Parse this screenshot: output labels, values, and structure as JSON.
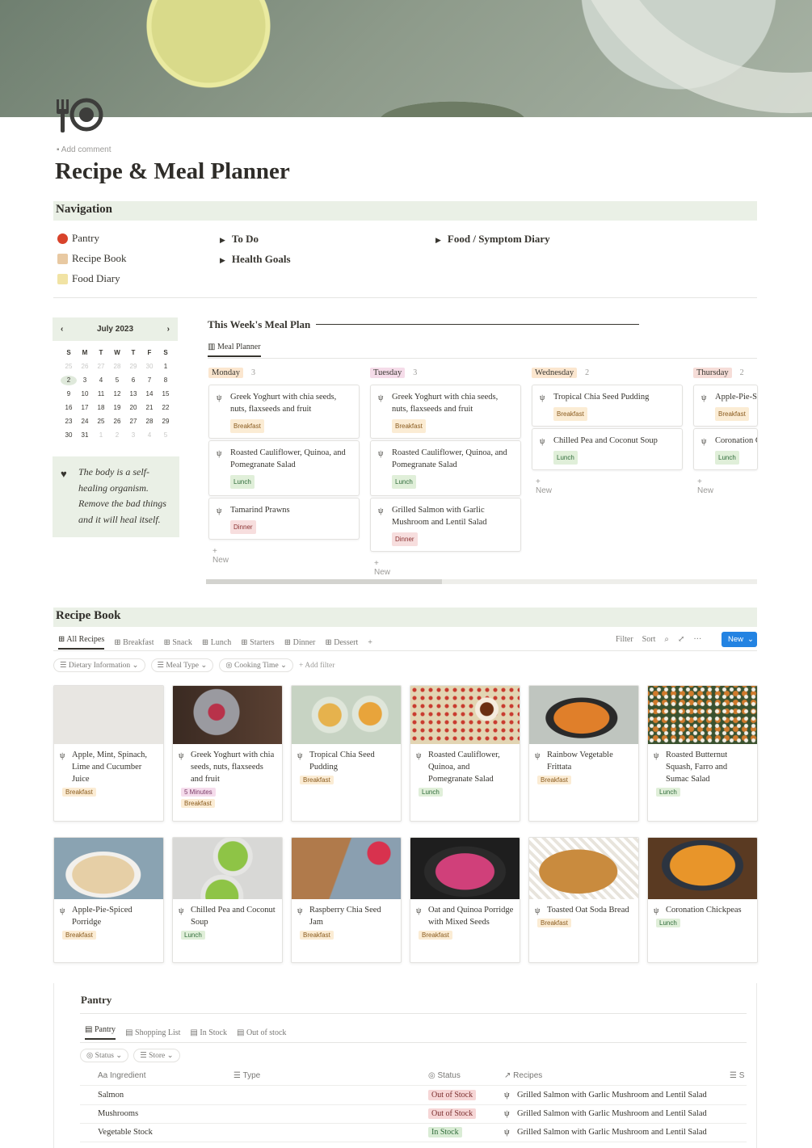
{
  "header": {
    "add_comment": "Add comment",
    "title": "Recipe & Meal Planner",
    "icon": "fork-plate-icon"
  },
  "navigation": {
    "heading": "Navigation",
    "links": [
      {
        "label": "Pantry",
        "icon": "tomato-icon"
      },
      {
        "label": "Recipe Book",
        "icon": "chef-icon"
      },
      {
        "label": "Food Diary",
        "icon": "notepad-icon"
      }
    ],
    "toggles_col2": [
      "To Do",
      "Health Goals"
    ],
    "toggles_col3": [
      "Food / Symptom Diary"
    ]
  },
  "calendar": {
    "month": "July 2023",
    "dow": [
      "S",
      "M",
      "T",
      "W",
      "T",
      "F",
      "S"
    ],
    "weeks": [
      [
        "25",
        "26",
        "27",
        "28",
        "29",
        "30",
        "1"
      ],
      [
        "2",
        "3",
        "4",
        "5",
        "6",
        "7",
        "8"
      ],
      [
        "9",
        "10",
        "11",
        "12",
        "13",
        "14",
        "15"
      ],
      [
        "16",
        "17",
        "18",
        "19",
        "20",
        "21",
        "22"
      ],
      [
        "23",
        "24",
        "25",
        "26",
        "27",
        "28",
        "29"
      ],
      [
        "30",
        "31",
        "1",
        "2",
        "3",
        "4",
        "5"
      ]
    ],
    "selected": "2"
  },
  "quote": {
    "text": "The body is a self-healing organism. Remove the bad things and it will heal itself."
  },
  "meal_plan": {
    "heading": "This Week's Meal Plan",
    "view_tab": "Meal Planner",
    "new_label": "New",
    "columns": [
      {
        "day": "Monday",
        "count": "3",
        "cards": [
          {
            "title": "Greek Yoghurt with chia seeds, nuts, flaxseeds and fruit",
            "tag": "Breakfast"
          },
          {
            "title": "Roasted Cauliflower, Quinoa, and Pomegranate Salad",
            "tag": "Lunch"
          },
          {
            "title": "Tamarind Prawns",
            "tag": "Dinner"
          }
        ]
      },
      {
        "day": "Tuesday",
        "count": "3",
        "cards": [
          {
            "title": "Greek Yoghurt with chia seeds, nuts, flaxseeds and fruit",
            "tag": "Breakfast"
          },
          {
            "title": "Roasted Cauliflower, Quinoa, and Pomegranate Salad",
            "tag": "Lunch"
          },
          {
            "title": "Grilled Salmon with Garlic Mushroom and Lentil Salad",
            "tag": "Dinner"
          }
        ]
      },
      {
        "day": "Wednesday",
        "count": "2",
        "cards": [
          {
            "title": "Tropical Chia Seed Pudding",
            "tag": "Breakfast"
          },
          {
            "title": "Chilled Pea and Coconut Soup",
            "tag": "Lunch"
          }
        ]
      },
      {
        "day": "Thursday",
        "count": "2",
        "cards": [
          {
            "title": "Apple-Pie-Sp",
            "tag": "Breakfast"
          },
          {
            "title": "Coronation C",
            "tag": "Lunch"
          }
        ]
      }
    ]
  },
  "recipe_book": {
    "heading": "Recipe Book",
    "tabs": [
      "All Recipes",
      "Breakfast",
      "Snack",
      "Lunch",
      "Starters",
      "Dinner",
      "Dessert"
    ],
    "actions": {
      "filter": "Filter",
      "sort": "Sort",
      "new": "New"
    },
    "filters": [
      "Dietary Information",
      "Meal Type",
      "Cooking Time"
    ],
    "add_filter": "Add filter",
    "cards": [
      {
        "title": "Apple, Mint, Spinach, Lime and Cucumber Juice",
        "tags": [
          "Breakfast"
        ]
      },
      {
        "title": "Greek Yoghurt with chia seeds, nuts, flaxseeds and fruit",
        "tags": [
          "5 Minutes",
          "Breakfast"
        ]
      },
      {
        "title": "Tropical Chia Seed Pudding",
        "tags": [
          "Breakfast"
        ]
      },
      {
        "title": "Roasted Cauliflower, Quinoa, and Pomegranate Salad",
        "tags": [
          "Lunch"
        ]
      },
      {
        "title": "Rainbow Vegetable Frittata",
        "tags": [
          "Breakfast"
        ]
      },
      {
        "title": "Roasted Butternut Squash, Farro and Sumac Salad",
        "tags": [
          "Lunch"
        ]
      },
      {
        "title": "Apple-Pie-Spiced Porridge",
        "tags": [
          "Breakfast"
        ]
      },
      {
        "title": "Chilled Pea and Coconut Soup",
        "tags": [
          "Lunch"
        ]
      },
      {
        "title": "Raspberry Chia Seed Jam",
        "tags": [
          "Breakfast"
        ]
      },
      {
        "title": "Oat and Quinoa Porridge with Mixed Seeds",
        "tags": [
          "Breakfast"
        ]
      },
      {
        "title": "Toasted Oat Soda Bread",
        "tags": [
          "Breakfast"
        ]
      },
      {
        "title": "Coronation Chickpeas",
        "tags": [
          "Lunch"
        ]
      }
    ]
  },
  "pantry": {
    "heading": "Pantry",
    "tabs": [
      "Pantry",
      "Shopping List",
      "In Stock",
      "Out of stock"
    ],
    "filters": [
      "Status",
      "Store"
    ],
    "columns": [
      "Ingredient",
      "Type",
      "Status",
      "Recipes",
      "S"
    ],
    "rows": [
      {
        "ingredient": "Salmon",
        "status": "Out of Stock",
        "recipe": "Grilled Salmon with Garlic Mushroom and Lentil Salad"
      },
      {
        "ingredient": "Mushrooms",
        "status": "Out of Stock",
        "recipe": "Grilled Salmon with Garlic Mushroom and Lentil Salad"
      },
      {
        "ingredient": "Vegetable Stock",
        "status": "In Stock",
        "recipe": "Grilled Salmon with Garlic Mushroom and Lentil Salad"
      }
    ]
  }
}
